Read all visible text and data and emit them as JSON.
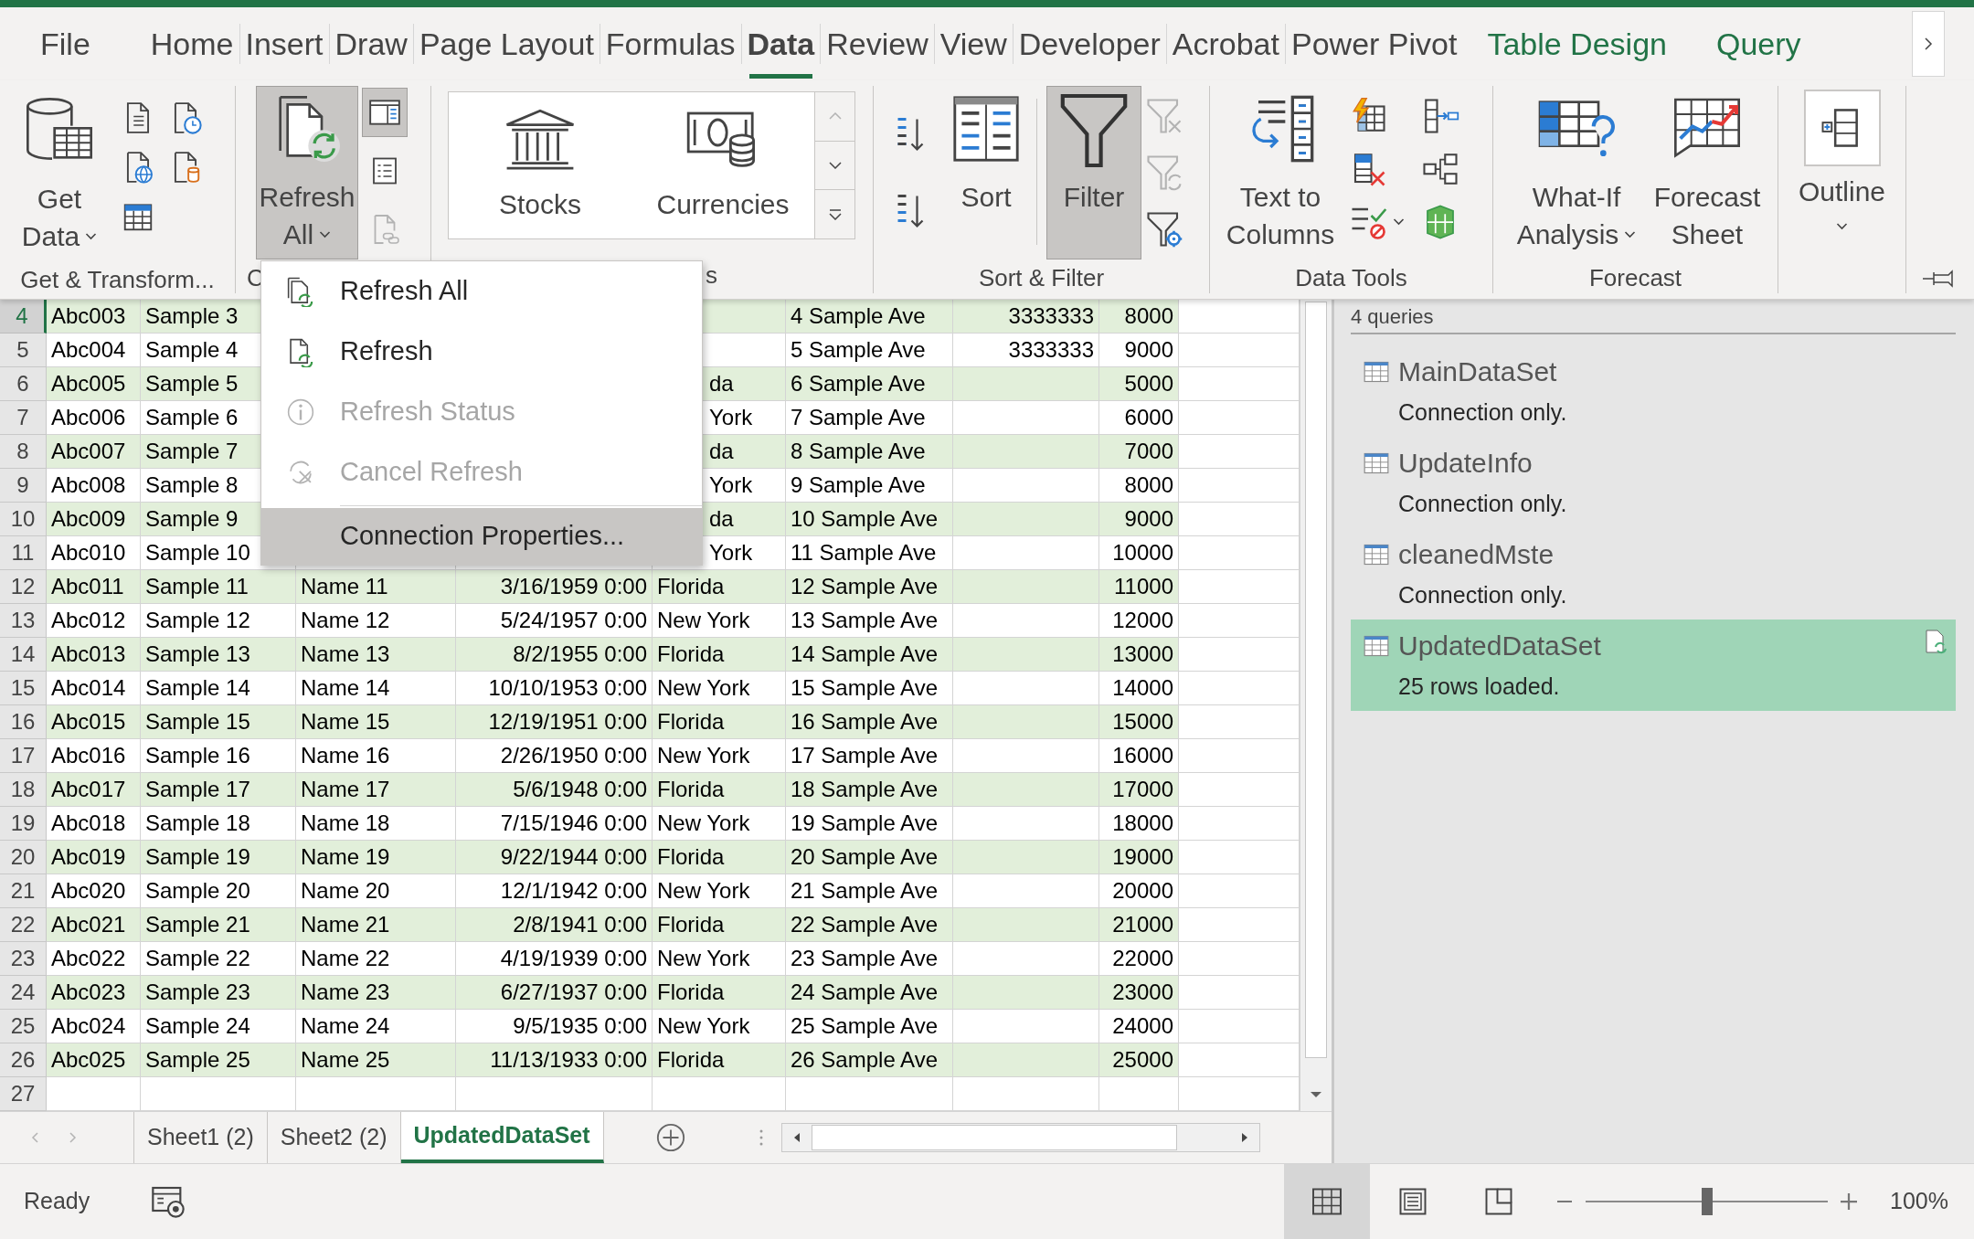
{
  "tabs": [
    {
      "label": "File",
      "selected": false,
      "contextual": false
    },
    {
      "label": "Home",
      "selected": false,
      "contextual": false
    },
    {
      "label": "Insert",
      "selected": false,
      "contextual": false
    },
    {
      "label": "Draw",
      "selected": false,
      "contextual": false
    },
    {
      "label": "Page Layout",
      "selected": false,
      "contextual": false
    },
    {
      "label": "Formulas",
      "selected": false,
      "contextual": false
    },
    {
      "label": "Data",
      "selected": true,
      "contextual": false
    },
    {
      "label": "Review",
      "selected": false,
      "contextual": false
    },
    {
      "label": "View",
      "selected": false,
      "contextual": false
    },
    {
      "label": "Developer",
      "selected": false,
      "contextual": false
    },
    {
      "label": "Acrobat",
      "selected": false,
      "contextual": false
    },
    {
      "label": "Power Pivot",
      "selected": false,
      "contextual": false
    },
    {
      "label": "Table Design",
      "selected": false,
      "contextual": true
    },
    {
      "label": "Query",
      "selected": false,
      "contextual": true
    }
  ],
  "ribbon_groups": [
    {
      "label": "Get & Transform...",
      "large": [
        {
          "lines": [
            "Get",
            "Data"
          ],
          "dropdown": true,
          "pressed": false
        }
      ]
    },
    {
      "label": "C",
      "large": [
        {
          "lines": [
            "Refresh",
            "All"
          ],
          "dropdown": true,
          "pressed": true
        }
      ],
      "small": [
        {
          "pressed": true,
          "disabled": false
        },
        {
          "pressed": false,
          "disabled": false
        },
        {
          "pressed": false,
          "disabled": true
        }
      ]
    },
    {
      "label": "s",
      "gallery": [
        "Stocks",
        "Currencies"
      ]
    },
    {
      "label": "Sort & Filter",
      "large": [
        {
          "lines": [
            "Sort"
          ],
          "pressed": false
        },
        {
          "lines": [
            "Filter"
          ],
          "pressed": true
        }
      ],
      "small": [
        {
          "disabled": true
        },
        {
          "disabled": true
        },
        {
          "disabled": false
        }
      ]
    },
    {
      "label": "Data Tools",
      "large": [
        {
          "lines": [
            "Text to",
            "Columns"
          ],
          "dropdown": false,
          "pressed": false
        }
      ]
    },
    {
      "label": "Forecast",
      "large": [
        {
          "lines": [
            "What-If",
            "Analysis"
          ],
          "dropdown": true,
          "pressed": false
        },
        {
          "lines": [
            "Forecast",
            "Sheet"
          ],
          "dropdown": false,
          "pressed": false
        }
      ]
    },
    {
      "large": [
        {
          "lines": [
            "Outline"
          ],
          "dropdown": true,
          "pressed": false
        }
      ]
    }
  ],
  "refresh_menu": [
    {
      "kind": "command",
      "label": "Refresh All",
      "disabled": false,
      "highlighted": false
    },
    {
      "kind": "command",
      "label": "Refresh",
      "disabled": false,
      "highlighted": false
    },
    {
      "kind": "command",
      "label": "Refresh Status",
      "disabled": true,
      "highlighted": false
    },
    {
      "kind": "command",
      "label": "Cancel Refresh",
      "disabled": true,
      "highlighted": false
    },
    {
      "kind": "separator"
    },
    {
      "kind": "command",
      "label": "Connection Properties...",
      "disabled": false,
      "highlighted": true
    }
  ],
  "rows": [
    {
      "num": "4",
      "selected": true,
      "cells": {
        "col_1": "Abc003",
        "col_2": "Sample 3",
        "col_6": "4 Sample Ave",
        "col_7": "3333333",
        "col_8": "8000"
      }
    },
    {
      "num": "5",
      "selected": false,
      "cells": {
        "col_1": "Abc004",
        "col_2": "Sample 4",
        "col_6": "5 Sample Ave",
        "col_7": "3333333",
        "col_8": "9000"
      }
    },
    {
      "num": "6",
      "selected": false,
      "cells": {
        "col_1": "Abc005",
        "col_2": "Sample 5",
        "col_5": "da",
        "col_6": "6 Sample Ave",
        "col_8": "5000"
      }
    },
    {
      "num": "7",
      "selected": false,
      "cells": {
        "col_1": "Abc006",
        "col_2": "Sample 6",
        "col_5": "York",
        "col_6": "7 Sample Ave",
        "col_8": "6000"
      }
    },
    {
      "num": "8",
      "selected": false,
      "cells": {
        "col_1": "Abc007",
        "col_2": "Sample 7",
        "col_5": "da",
        "col_6": "8 Sample Ave",
        "col_8": "7000"
      }
    },
    {
      "num": "9",
      "selected": false,
      "cells": {
        "col_1": "Abc008",
        "col_2": "Sample 8",
        "col_5": "York",
        "col_6": "9 Sample Ave",
        "col_8": "8000"
      }
    },
    {
      "num": "10",
      "selected": false,
      "cells": {
        "col_1": "Abc009",
        "col_2": "Sample 9",
        "col_5": "da",
        "col_6": "10 Sample Ave",
        "col_8": "9000"
      }
    },
    {
      "num": "11",
      "selected": false,
      "cells": {
        "col_1": "Abc010",
        "col_2": "Sample 10",
        "col_5": "York",
        "col_6": "11 Sample Ave",
        "col_8": "10000"
      }
    },
    {
      "num": "12",
      "selected": false,
      "cells": {
        "col_1": "Abc011",
        "col_2": "Sample 11",
        "col_3": "Name 11",
        "col_4": "3/16/1959 0:00",
        "col_5": "Florida",
        "col_6": "12 Sample Ave",
        "col_8": "11000"
      }
    },
    {
      "num": "13",
      "selected": false,
      "cells": {
        "col_1": "Abc012",
        "col_2": "Sample 12",
        "col_3": "Name 12",
        "col_4": "5/24/1957 0:00",
        "col_5": "New York",
        "col_6": "13 Sample Ave",
        "col_8": "12000"
      }
    },
    {
      "num": "14",
      "selected": false,
      "cells": {
        "col_1": "Abc013",
        "col_2": "Sample 13",
        "col_3": "Name 13",
        "col_4": "8/2/1955 0:00",
        "col_5": "Florida",
        "col_6": "14 Sample Ave",
        "col_8": "13000"
      }
    },
    {
      "num": "15",
      "selected": false,
      "cells": {
        "col_1": "Abc014",
        "col_2": "Sample 14",
        "col_3": "Name 14",
        "col_4": "10/10/1953 0:00",
        "col_5": "New York",
        "col_6": "15 Sample Ave",
        "col_8": "14000"
      }
    },
    {
      "num": "16",
      "selected": false,
      "cells": {
        "col_1": "Abc015",
        "col_2": "Sample 15",
        "col_3": "Name 15",
        "col_4": "12/19/1951 0:00",
        "col_5": "Florida",
        "col_6": "16 Sample Ave",
        "col_8": "15000"
      }
    },
    {
      "num": "17",
      "selected": false,
      "cells": {
        "col_1": "Abc016",
        "col_2": "Sample 16",
        "col_3": "Name 16",
        "col_4": "2/26/1950 0:00",
        "col_5": "New York",
        "col_6": "17 Sample Ave",
        "col_8": "16000"
      }
    },
    {
      "num": "18",
      "selected": false,
      "cells": {
        "col_1": "Abc017",
        "col_2": "Sample 17",
        "col_3": "Name 17",
        "col_4": "5/6/1948 0:00",
        "col_5": "Florida",
        "col_6": "18 Sample Ave",
        "col_8": "17000"
      }
    },
    {
      "num": "19",
      "selected": false,
      "cells": {
        "col_1": "Abc018",
        "col_2": "Sample 18",
        "col_3": "Name 18",
        "col_4": "7/15/1946 0:00",
        "col_5": "New York",
        "col_6": "19 Sample Ave",
        "col_8": "18000"
      }
    },
    {
      "num": "20",
      "selected": false,
      "cells": {
        "col_1": "Abc019",
        "col_2": "Sample 19",
        "col_3": "Name 19",
        "col_4": "9/22/1944 0:00",
        "col_5": "Florida",
        "col_6": "20 Sample Ave",
        "col_8": "19000"
      }
    },
    {
      "num": "21",
      "selected": false,
      "cells": {
        "col_1": "Abc020",
        "col_2": "Sample 20",
        "col_3": "Name 20",
        "col_4": "12/1/1942 0:00",
        "col_5": "New York",
        "col_6": "21 Sample Ave",
        "col_8": "20000"
      }
    },
    {
      "num": "22",
      "selected": false,
      "cells": {
        "col_1": "Abc021",
        "col_2": "Sample 21",
        "col_3": "Name 21",
        "col_4": "2/8/1941 0:00",
        "col_5": "Florida",
        "col_6": "22 Sample Ave",
        "col_8": "21000"
      }
    },
    {
      "num": "23",
      "selected": false,
      "cells": {
        "col_1": "Abc022",
        "col_2": "Sample 22",
        "col_3": "Name 22",
        "col_4": "4/19/1939 0:00",
        "col_5": "New York",
        "col_6": "23 Sample Ave",
        "col_8": "22000"
      }
    },
    {
      "num": "24",
      "selected": false,
      "cells": {
        "col_1": "Abc023",
        "col_2": "Sample 23",
        "col_3": "Name 23",
        "col_4": "6/27/1937 0:00",
        "col_5": "Florida",
        "col_6": "24 Sample Ave",
        "col_8": "23000"
      }
    },
    {
      "num": "25",
      "selected": false,
      "cells": {
        "col_1": "Abc024",
        "col_2": "Sample 24",
        "col_3": "Name 24",
        "col_4": "9/5/1935 0:00",
        "col_5": "New York",
        "col_6": "25 Sample Ave",
        "col_8": "24000"
      }
    },
    {
      "num": "26",
      "selected": false,
      "cells": {
        "col_1": "Abc025",
        "col_2": "Sample 25",
        "col_3": "Name 25",
        "col_4": "11/13/1933 0:00",
        "col_5": "Florida",
        "col_6": "26 Sample Ave",
        "col_8": "25000"
      }
    },
    {
      "num": "27",
      "selected": false,
      "cells": {}
    }
  ],
  "sheet_tabs": [
    {
      "label": "Sheet1 (2)",
      "selected": false
    },
    {
      "label": "Sheet2 (2)",
      "selected": false
    },
    {
      "label": "UpdatedDataSet",
      "selected": true
    }
  ],
  "queries_pane": {
    "count": "4 queries",
    "queries": [
      {
        "name": "MainDataSet",
        "status": "Connection only.",
        "selected": false
      },
      {
        "name": "UpdateInfo",
        "status": "Connection only.",
        "selected": false
      },
      {
        "name": "cleanedMste",
        "status": "Connection only.",
        "selected": false
      },
      {
        "name": "UpdatedDataSet",
        "status": "25 rows loaded.",
        "selected": true
      }
    ]
  },
  "status_bar": {
    "text": "Ready",
    "views": [
      {
        "selected": true
      },
      {
        "selected": false
      },
      {
        "selected": false
      }
    ],
    "zoom": {
      "level": 0.5,
      "reading": "100%"
    }
  }
}
